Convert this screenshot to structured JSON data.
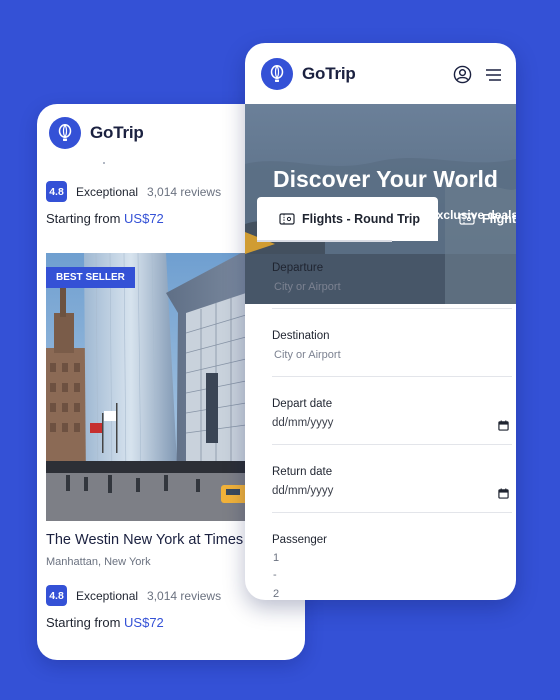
{
  "brand": {
    "name": "GoTrip"
  },
  "listing": {
    "rating_top": {
      "score": "4.8",
      "label": "Exceptional",
      "reviews": "3,014 reviews"
    },
    "price_top": {
      "prefix": "Starting from ",
      "amount": "US$72"
    },
    "hotel": {
      "badge": "BEST SELLER",
      "name": "The Westin New York at Times",
      "location": "Manhattan, New York",
      "rating": {
        "score": "4.8",
        "label": "Exceptional",
        "reviews": "3,014 reviews"
      },
      "price": {
        "prefix": "Starting from ",
        "amount": "US$72"
      }
    }
  },
  "booking": {
    "hero": {
      "title": "Discover Your World",
      "subtitle": "Discover amazing places at exclusive deals"
    },
    "tabs": [
      {
        "label": "Flights - Round Trip",
        "active": true
      },
      {
        "label": "Flight",
        "active": false
      }
    ],
    "fields": {
      "departure": {
        "label": "Departure",
        "placeholder": "City or Airport"
      },
      "destination": {
        "label": "Destination",
        "placeholder": "City or Airport"
      },
      "depart_date": {
        "label": "Depart date",
        "value": "dd/mm/yyyy"
      },
      "return_date": {
        "label": "Return date",
        "value": "dd/mm/yyyy"
      },
      "passenger": {
        "label": "Passenger",
        "options": [
          "1",
          "-",
          "2"
        ]
      }
    }
  },
  "colors": {
    "background": "#3451d6",
    "accent": "#3451d6",
    "card": "#ffffff"
  },
  "icons": [
    "hot-air-balloon-logo-icon",
    "user-circle-icon",
    "hamburger-menu-icon",
    "ticket-icon",
    "calendar-icon"
  ]
}
